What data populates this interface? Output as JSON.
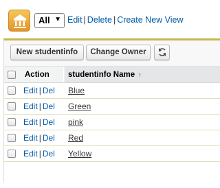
{
  "view": {
    "selected": "All",
    "links": [
      "Edit",
      "Delete",
      "Create New View"
    ]
  },
  "toolbar": {
    "new_label": "New studentinfo",
    "owner_label": "Change Owner",
    "refresh_icon": "refresh-icon"
  },
  "table": {
    "columns": [
      "Action",
      "studentinfo Name"
    ],
    "sort_indicator": "↑",
    "action_edit": "Edit",
    "action_del": "Del",
    "rows": [
      {
        "name": "Blue"
      },
      {
        "name": "Green"
      },
      {
        "name": "pink"
      },
      {
        "name": "Red"
      },
      {
        "name": "Yellow"
      }
    ]
  },
  "colors": {
    "link": "#015ba7",
    "accent_border": "#c5b64e",
    "icon_orange": "#e0962a"
  }
}
